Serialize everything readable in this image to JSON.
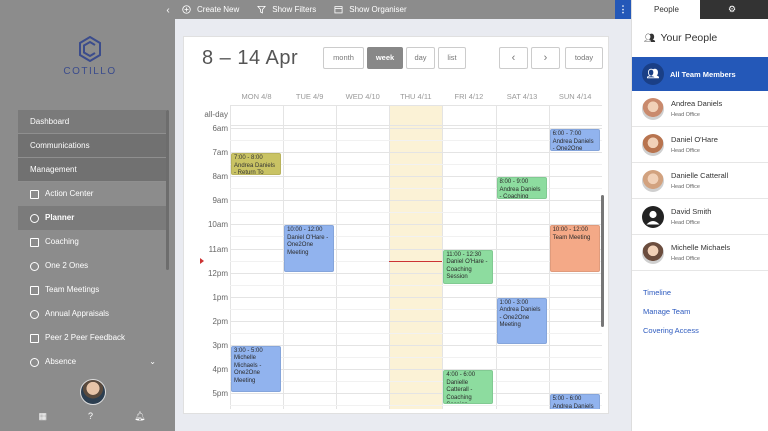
{
  "app": {
    "logo_text": "COTILLO"
  },
  "toolbar": {
    "create_new": "Create New",
    "show_filters": "Show Filters",
    "show_organiser": "Show Organiser",
    "more": "⋮"
  },
  "sidebar": {
    "items": [
      {
        "label": "Dashboard",
        "kind": "section"
      },
      {
        "label": "Communications",
        "kind": "section"
      },
      {
        "label": "Management",
        "kind": "section"
      },
      {
        "label": "Action Center",
        "icon": "gear-icon"
      },
      {
        "label": "Planner",
        "icon": "calendar-icon",
        "active": true
      },
      {
        "label": "Coaching",
        "icon": "compass-icon"
      },
      {
        "label": "One 2 Ones",
        "icon": "chat-icon"
      },
      {
        "label": "Team Meetings",
        "icon": "video-icon"
      },
      {
        "label": "Annual Appraisals",
        "icon": "document-icon"
      },
      {
        "label": "Peer 2 Peer Feedback",
        "icon": "feedback-icon"
      },
      {
        "label": "Absence",
        "icon": "absence-icon",
        "expandable": true
      }
    ],
    "bottom": {
      "help": "?"
    }
  },
  "calendar": {
    "title": "8 – 14 Apr",
    "views": [
      "month",
      "week",
      "day",
      "list"
    ],
    "active_view": "week",
    "prev": "‹",
    "next": "›",
    "today": "today",
    "days": [
      "MON 4/8",
      "TUE 4/9",
      "WED 4/10",
      "THU 4/11",
      "FRI 4/12",
      "SAT 4/13",
      "SUN 4/14"
    ],
    "today_index": 3,
    "allday_label": "all-day",
    "hours": [
      "6am",
      "7am",
      "8am",
      "9am",
      "10am",
      "11am",
      "12pm",
      "1pm",
      "2pm",
      "3pm",
      "4pm",
      "5pm"
    ],
    "now_hour": 11.5,
    "events": [
      {
        "day": 0,
        "start": 7,
        "end": 8,
        "time": "7:00 - 8:00",
        "text": "Andrea Daniels - Return To Work",
        "color": "#c9c364",
        "text_color": "#333"
      },
      {
        "day": 1,
        "start": 10,
        "end": 12,
        "time": "10:00 - 12:00",
        "text": "Daniel O'Hare - One2One Meeting",
        "color": "#91b3ee",
        "text_color": "#2a2a2a"
      },
      {
        "day": 0,
        "start": 15,
        "end": 17,
        "time": "3:00 - 5:00",
        "text": "Michelle Michaels - One2One Meeting",
        "color": "#91b3ee",
        "text_color": "#2a2a2a"
      },
      {
        "day": 4,
        "start": 11,
        "end": 12.5,
        "time": "11:00 - 12:30",
        "text": "Daniel O'Hare - Coaching Session",
        "color": "#8ddc9f",
        "text_color": "#2a2a2a"
      },
      {
        "day": 4,
        "start": 16,
        "end": 17.5,
        "time": "4:00 - 6:00",
        "text": "Danielle Catterall - Coaching Session",
        "color": "#8ddc9f",
        "text_color": "#2a2a2a"
      },
      {
        "day": 5,
        "start": 8,
        "end": 9,
        "time": "8:00 - 9:00",
        "text": "Andrea Daniels - Coaching",
        "color": "#8ddc9f",
        "text_color": "#2a2a2a"
      },
      {
        "day": 5,
        "start": 13,
        "end": 15,
        "time": "1:00 - 3:00",
        "text": "Andrea Daniels - One2One Meeting",
        "color": "#91b3ee",
        "text_color": "#2a2a2a"
      },
      {
        "day": 6,
        "start": 6,
        "end": 7,
        "time": "6:00 - 7:00",
        "text": "Andrea Daniels - One2One",
        "color": "#91b3ee",
        "text_color": "#2a2a2a"
      },
      {
        "day": 6,
        "start": 10,
        "end": 12,
        "time": "10:00 - 12:00",
        "text": "Team Meeting",
        "color": "#f4a987",
        "text_color": "#2a2a2a"
      },
      {
        "day": 6,
        "start": 17,
        "end": 18,
        "time": "5:00 - 6:00",
        "text": "Andrea Daniels -",
        "color": "#91b3ee",
        "text_color": "#2a2a2a"
      }
    ]
  },
  "people_panel": {
    "tab_people": "People",
    "tab_settings_icon": "gear-icon",
    "heading": "Your People",
    "all_members": "All Team Members",
    "people": [
      {
        "name": "Andrea Daniels",
        "dept": "Head Office",
        "avatar": "#c98a6d"
      },
      {
        "name": "Daniel O'Hare",
        "dept": "Head Office",
        "avatar": "#b8744f"
      },
      {
        "name": "Danielle Catterall",
        "dept": "Head Office",
        "avatar": "#d2a27f"
      },
      {
        "name": "David Smith",
        "dept": "Head Office",
        "avatar": "#222222",
        "placeholder": true
      },
      {
        "name": "Michelle Michaels",
        "dept": "Head Office",
        "avatar": "#6b4d3e"
      }
    ],
    "links": [
      "Timeline",
      "Manage Team",
      "Covering Access"
    ]
  }
}
